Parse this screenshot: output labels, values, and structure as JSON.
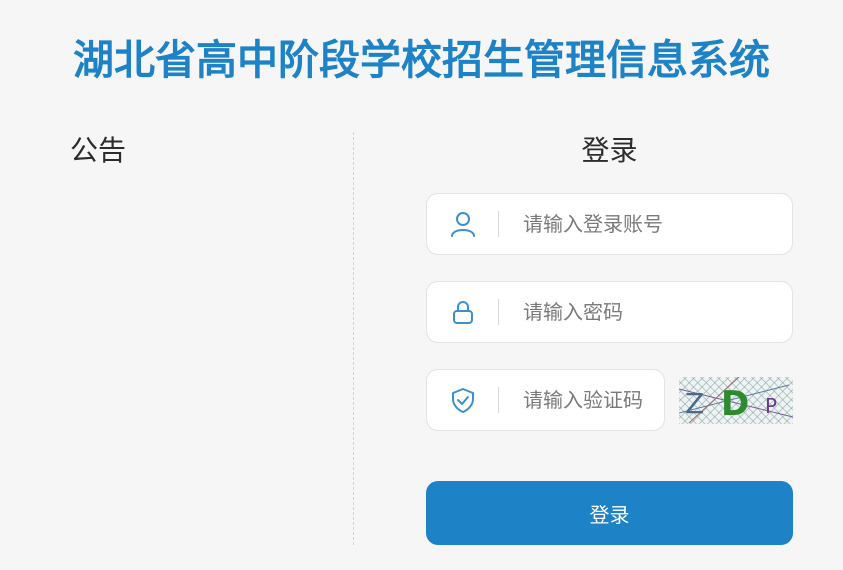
{
  "page_title": "湖北省高中阶段学校招生管理信息系统",
  "notice": {
    "heading": "公告"
  },
  "login": {
    "heading": "登录",
    "account_placeholder": "请输入登录账号",
    "account_icon": "user-icon",
    "password_placeholder": "请输入密码",
    "password_icon": "lock-icon",
    "captcha_placeholder": "请输入验证码",
    "captcha_icon": "shield-check-icon",
    "captcha_text": "ZDP",
    "submit_label": "登录"
  },
  "colors": {
    "brand": "#1d82c6",
    "background": "#f6f6f6",
    "icon": "#3b8fce"
  }
}
